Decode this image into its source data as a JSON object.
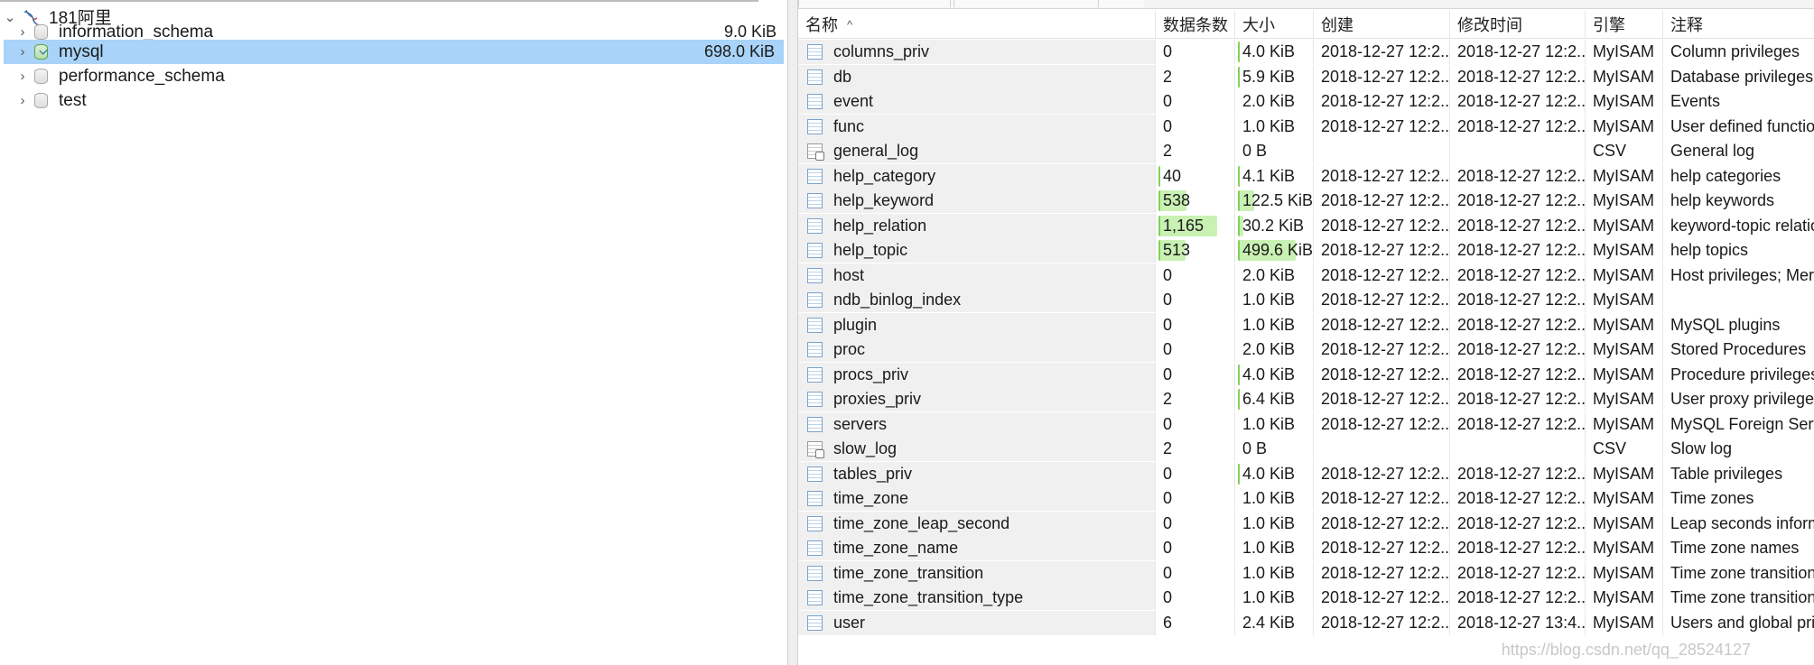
{
  "tree": {
    "connection": {
      "label": "181阿里",
      "expanded": true
    },
    "databases": [
      {
        "name": "information_schema",
        "size": "9.0 KiB",
        "open": false,
        "selected": false
      },
      {
        "name": "mysql",
        "size": "698.0 KiB",
        "open": true,
        "selected": true
      },
      {
        "name": "performance_schema",
        "size": "",
        "open": false,
        "selected": false
      },
      {
        "name": "test",
        "size": "",
        "open": false,
        "selected": false
      }
    ]
  },
  "table_list": {
    "headers": [
      "名称",
      "数据条数",
      "大小",
      "创建",
      "修改时间",
      "引擎",
      "注释"
    ],
    "sort_indicator": "^",
    "rows": [
      {
        "name": "columns_priv",
        "rows": "0",
        "size": "4.0 KiB",
        "created": "2018-12-27 12:2...",
        "modified": "2018-12-27 12:2...",
        "engine": "MyISAM",
        "comment": "Column privileges",
        "rows_frac": 0,
        "size_frac": 0.01
      },
      {
        "name": "db",
        "rows": "2",
        "size": "5.9 KiB",
        "created": "2018-12-27 12:2...",
        "modified": "2018-12-27 12:2...",
        "engine": "MyISAM",
        "comment": "Database privileges",
        "rows_frac": 0,
        "size_frac": 0.01
      },
      {
        "name": "event",
        "rows": "0",
        "size": "2.0 KiB",
        "created": "2018-12-27 12:2...",
        "modified": "2018-12-27 12:2...",
        "engine": "MyISAM",
        "comment": "Events",
        "rows_frac": 0,
        "size_frac": 0
      },
      {
        "name": "func",
        "rows": "0",
        "size": "1.0 KiB",
        "created": "2018-12-27 12:2...",
        "modified": "2018-12-27 12:2...",
        "engine": "MyISAM",
        "comment": "User defined functions",
        "rows_frac": 0,
        "size_frac": 0
      },
      {
        "name": "general_log",
        "rows": "2",
        "size": "0 B",
        "created": "",
        "modified": "",
        "engine": "CSV",
        "comment": "General log",
        "log": true,
        "rows_frac": 0,
        "size_frac": 0
      },
      {
        "name": "help_category",
        "rows": "40",
        "size": "4.1 KiB",
        "created": "2018-12-27 12:2...",
        "modified": "2018-12-27 12:2...",
        "engine": "MyISAM",
        "comment": "help categories",
        "rows_frac": 0.03,
        "size_frac": 0.01
      },
      {
        "name": "help_keyword",
        "rows": "538",
        "size": "122.5 KiB",
        "created": "2018-12-27 12:2...",
        "modified": "2018-12-27 12:2...",
        "engine": "MyISAM",
        "comment": "help keywords",
        "rows_frac": 0.46,
        "size_frac": 0.25
      },
      {
        "name": "help_relation",
        "rows": "1,165",
        "size": "30.2 KiB",
        "created": "2018-12-27 12:2...",
        "modified": "2018-12-27 12:2...",
        "engine": "MyISAM",
        "comment": "keyword-topic relation",
        "rows_frac": 1.0,
        "size_frac": 0.06
      },
      {
        "name": "help_topic",
        "rows": "513",
        "size": "499.6 KiB",
        "created": "2018-12-27 12:2...",
        "modified": "2018-12-27 12:2...",
        "engine": "MyISAM",
        "comment": "help topics",
        "rows_frac": 0.44,
        "size_frac": 1.0
      },
      {
        "name": "host",
        "rows": "0",
        "size": "2.0 KiB",
        "created": "2018-12-27 12:2...",
        "modified": "2018-12-27 12:2...",
        "engine": "MyISAM",
        "comment": "Host privileges;  Merged",
        "rows_frac": 0,
        "size_frac": 0
      },
      {
        "name": "ndb_binlog_index",
        "rows": "0",
        "size": "1.0 KiB",
        "created": "2018-12-27 12:2...",
        "modified": "2018-12-27 12:2...",
        "engine": "MyISAM",
        "comment": "",
        "rows_frac": 0,
        "size_frac": 0
      },
      {
        "name": "plugin",
        "rows": "0",
        "size": "1.0 KiB",
        "created": "2018-12-27 12:2...",
        "modified": "2018-12-27 12:2...",
        "engine": "MyISAM",
        "comment": "MySQL plugins",
        "rows_frac": 0,
        "size_frac": 0
      },
      {
        "name": "proc",
        "rows": "0",
        "size": "2.0 KiB",
        "created": "2018-12-27 12:2...",
        "modified": "2018-12-27 12:2...",
        "engine": "MyISAM",
        "comment": "Stored Procedures",
        "rows_frac": 0,
        "size_frac": 0
      },
      {
        "name": "procs_priv",
        "rows": "0",
        "size": "4.0 KiB",
        "created": "2018-12-27 12:2...",
        "modified": "2018-12-27 12:2...",
        "engine": "MyISAM",
        "comment": "Procedure privileges",
        "rows_frac": 0,
        "size_frac": 0.01
      },
      {
        "name": "proxies_priv",
        "rows": "2",
        "size": "6.4 KiB",
        "created": "2018-12-27 12:2...",
        "modified": "2018-12-27 12:2...",
        "engine": "MyISAM",
        "comment": "User proxy privileges",
        "rows_frac": 0,
        "size_frac": 0.01
      },
      {
        "name": "servers",
        "rows": "0",
        "size": "1.0 KiB",
        "created": "2018-12-27 12:2...",
        "modified": "2018-12-27 12:2...",
        "engine": "MyISAM",
        "comment": "MySQL Foreign Servers",
        "rows_frac": 0,
        "size_frac": 0
      },
      {
        "name": "slow_log",
        "rows": "2",
        "size": "0 B",
        "created": "",
        "modified": "",
        "engine": "CSV",
        "comment": "Slow log",
        "log": true,
        "rows_frac": 0,
        "size_frac": 0
      },
      {
        "name": "tables_priv",
        "rows": "0",
        "size": "4.0 KiB",
        "created": "2018-12-27 12:2...",
        "modified": "2018-12-27 12:2...",
        "engine": "MyISAM",
        "comment": "Table privileges",
        "rows_frac": 0,
        "size_frac": 0.01
      },
      {
        "name": "time_zone",
        "rows": "0",
        "size": "1.0 KiB",
        "created": "2018-12-27 12:2...",
        "modified": "2018-12-27 12:2...",
        "engine": "MyISAM",
        "comment": "Time zones",
        "rows_frac": 0,
        "size_frac": 0
      },
      {
        "name": "time_zone_leap_second",
        "rows": "0",
        "size": "1.0 KiB",
        "created": "2018-12-27 12:2...",
        "modified": "2018-12-27 12:2...",
        "engine": "MyISAM",
        "comment": "Leap seconds information",
        "rows_frac": 0,
        "size_frac": 0
      },
      {
        "name": "time_zone_name",
        "rows": "0",
        "size": "1.0 KiB",
        "created": "2018-12-27 12:2...",
        "modified": "2018-12-27 12:2...",
        "engine": "MyISAM",
        "comment": "Time zone names",
        "rows_frac": 0,
        "size_frac": 0
      },
      {
        "name": "time_zone_transition",
        "rows": "0",
        "size": "1.0 KiB",
        "created": "2018-12-27 12:2...",
        "modified": "2018-12-27 12:2...",
        "engine": "MyISAM",
        "comment": "Time zone transitions",
        "rows_frac": 0,
        "size_frac": 0
      },
      {
        "name": "time_zone_transition_type",
        "rows": "0",
        "size": "1.0 KiB",
        "created": "2018-12-27 12:2...",
        "modified": "2018-12-27 12:2...",
        "engine": "MyISAM",
        "comment": "Time zone transition types",
        "rows_frac": 0,
        "size_frac": 0
      },
      {
        "name": "user",
        "rows": "6",
        "size": "2.4 KiB",
        "created": "2018-12-27 12:2...",
        "modified": "2018-12-27 13:4...",
        "engine": "MyISAM",
        "comment": "Users and global privileges",
        "rows_frac": 0,
        "size_frac": 0
      }
    ]
  },
  "watermark": "https://blog.csdn.net/qq_28524127",
  "colors": {
    "selection": "#a9d3f8",
    "bar_fill": "#c9f1b3",
    "bar_edge": "#7fd25a"
  }
}
